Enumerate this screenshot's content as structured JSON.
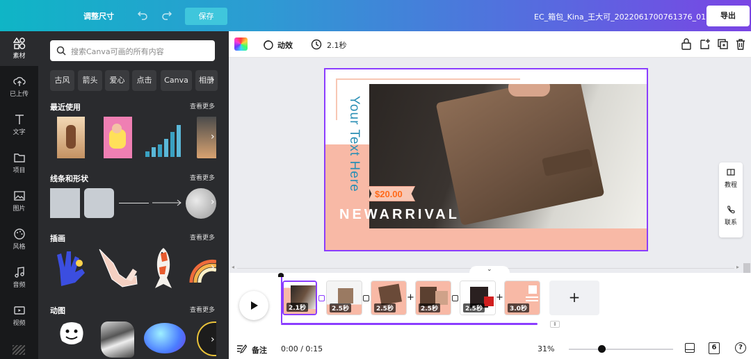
{
  "topbar": {
    "resize_label": "调整尺寸",
    "save_label": "保存",
    "file_name": "EC_箱包_Kina_王大可_2022061700761376_01",
    "export_label": "导出"
  },
  "nav": {
    "items": [
      {
        "label": "素材",
        "icon": "shapes-icon"
      },
      {
        "label": "已上传",
        "icon": "cloud-upload-icon"
      },
      {
        "label": "文字",
        "icon": "text-icon"
      },
      {
        "label": "项目",
        "icon": "folder-icon"
      },
      {
        "label": "图片",
        "icon": "image-icon"
      },
      {
        "label": "风格",
        "icon": "palette-icon"
      },
      {
        "label": "音频",
        "icon": "music-icon"
      },
      {
        "label": "视频",
        "icon": "video-icon"
      }
    ]
  },
  "panel": {
    "search_placeholder": "搜索Canva可画的所有内容",
    "chips": [
      "古风",
      "箭头",
      "爱心",
      "点击",
      "Canva",
      "相册"
    ],
    "see_more": "查看更多",
    "sections": {
      "recent": "最近使用",
      "lines": "线条和形状",
      "illustrations": "插画",
      "animations": "动图"
    }
  },
  "toolbar": {
    "animate_label": "动效",
    "duration_label": "2.1秒"
  },
  "design": {
    "vertical_text": "Your Text Here",
    "price": "$20.00",
    "headline": "NEWARRIVAL"
  },
  "side_widget": {
    "tutorial": "教程",
    "contact": "联系"
  },
  "timeline": {
    "clips": [
      {
        "duration": "2.1秒"
      },
      {
        "duration": "2.5秒"
      },
      {
        "duration": "2.5秒"
      },
      {
        "duration": "2.5秒"
      },
      {
        "duration": "2.5秒"
      },
      {
        "duration": "3.0秒"
      }
    ],
    "add_symbol": "+"
  },
  "bottombar": {
    "notes_label": "备注",
    "time": "0:00 / 0:15",
    "zoom": "31%",
    "zoom_fraction": 0.31,
    "page_count": "6",
    "help": "?"
  },
  "colors": {
    "accent_purple": "#8b3dff",
    "salmon": "#f8b9a6",
    "panel_bg": "#2a2b2e"
  }
}
